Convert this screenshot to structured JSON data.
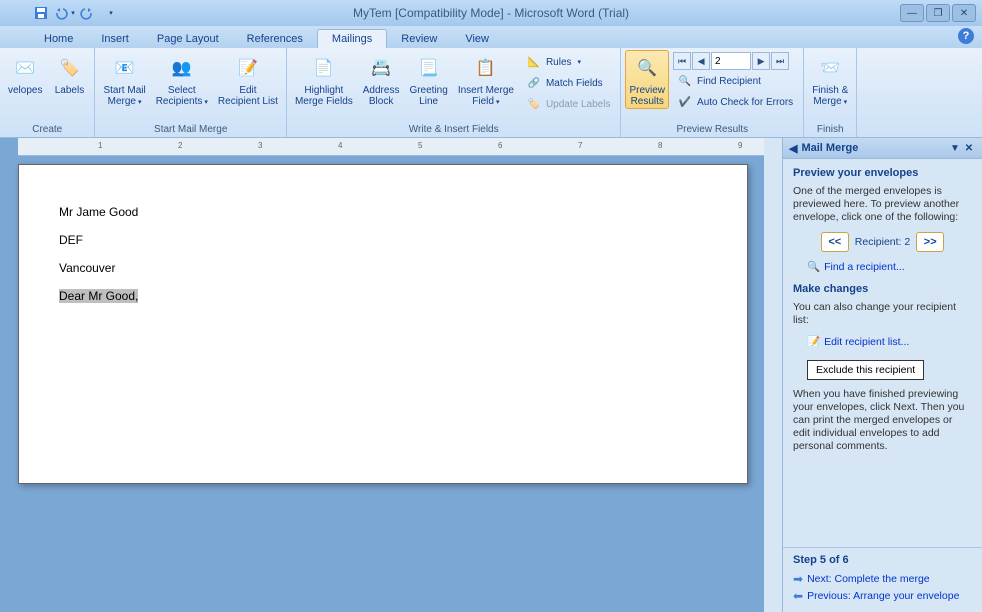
{
  "title": "MyTem [Compatibility Mode] - Microsoft Word (Trial)",
  "tabs": {
    "home": "Home",
    "insert": "Insert",
    "page_layout": "Page Layout",
    "references": "References",
    "mailings": "Mailings",
    "review": "Review",
    "view": "View"
  },
  "ribbon": {
    "create": {
      "label": "Create",
      "envelopes": "velopes",
      "labels": "Labels"
    },
    "start_mail_merge": {
      "label": "Start Mail Merge",
      "start": "Start Mail\nMerge",
      "select": "Select\nRecipients",
      "edit": "Edit\nRecipient List"
    },
    "write_insert": {
      "label": "Write & Insert Fields",
      "highlight": "Highlight\nMerge Fields",
      "address": "Address\nBlock",
      "greeting": "Greeting\nLine",
      "insert_merge": "Insert Merge\nField",
      "rules": "Rules",
      "match": "Match Fields",
      "update": "Update Labels"
    },
    "preview": {
      "label": "Preview Results",
      "btn": "Preview\nResults",
      "record": "2",
      "find": "Find Recipient",
      "autocheck": "Auto Check for Errors"
    },
    "finish": {
      "label": "Finish",
      "btn": "Finish &\nMerge"
    }
  },
  "ruler_nums": [
    "1",
    "2",
    "3",
    "4",
    "5",
    "6",
    "7",
    "8",
    "9"
  ],
  "document": {
    "line1": "Mr Jame Good",
    "line2": "DEF",
    "line3": "Vancouver",
    "greeting": "Dear Mr Good,"
  },
  "taskpane": {
    "title": "Mail Merge",
    "h1": "Preview your envelopes",
    "p1": "One of the merged envelopes is previewed here. To preview another envelope, click one of the following:",
    "recipient_label": "Recipient: 2",
    "find_link": "Find a recipient...",
    "h2": "Make changes",
    "p2": "You can also change your recipient list:",
    "edit_link": "Edit recipient list...",
    "exclude_btn": "Exclude this recipient",
    "p3": "When you have finished previewing your envelopes, click Next. Then you can print the merged envelopes or edit individual envelopes to add personal comments.",
    "step": "Step 5 of 6",
    "next": "Next: Complete the merge",
    "prev": "Previous: Arrange your envelope"
  }
}
